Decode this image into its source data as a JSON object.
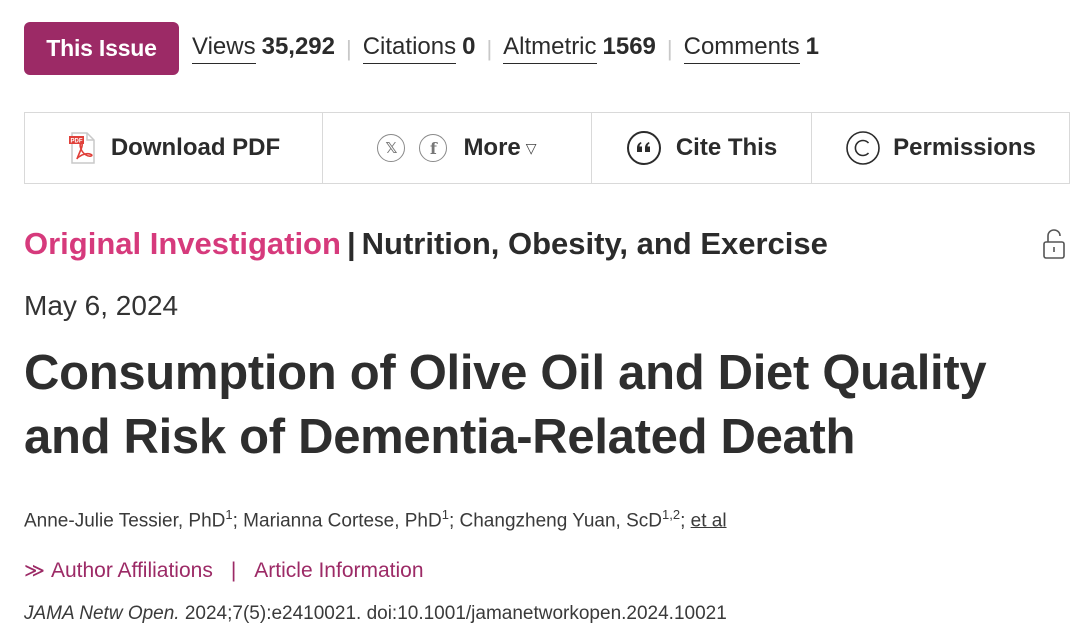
{
  "metrics_bar": {
    "issue_button": "This Issue",
    "views": {
      "label": "Views",
      "value": "35,292"
    },
    "citations": {
      "label": "Citations",
      "value": "0"
    },
    "altmetric": {
      "label": "Altmetric",
      "value": "1569"
    },
    "comments": {
      "label": "Comments",
      "value": "1"
    }
  },
  "toolbar": {
    "download_pdf": "Download PDF",
    "x_icon": "𝕏",
    "facebook_icon": "f",
    "more": "More",
    "cite_this": "Cite This",
    "permissions": "Permissions"
  },
  "article": {
    "type": "Original Investigation",
    "separator": "|",
    "topic": "Nutrition, Obesity, and Exercise",
    "date": "May 6, 2024",
    "title": "Consumption of Olive Oil and Diet Quality and Risk of Dementia-Related Death",
    "authors": [
      {
        "name": "Anne-Julie Tessier, PhD",
        "aff": "1"
      },
      {
        "name": "Marianna Cortese, PhD",
        "aff": "1"
      },
      {
        "name": "Changzheng Yuan, ScD",
        "aff": "1,2"
      }
    ],
    "et_al": "et al",
    "author_affiliations": "Author Affiliations",
    "article_information": "Article Information",
    "citation_journal": "JAMA Netw Open.",
    "citation_details": "2024;7(5):e2410021. doi:10.1001/jamanetworkopen.2024.10021"
  },
  "colors": {
    "brand_magenta": "#9c2a66",
    "category_pink": "#d63a7c",
    "text": "#2b2b2b"
  },
  "icons": [
    "pdf-icon",
    "x-icon",
    "facebook-icon",
    "caret-down-icon",
    "quote-icon",
    "copyright-icon",
    "unlock-icon",
    "chevron-right-icon"
  ]
}
